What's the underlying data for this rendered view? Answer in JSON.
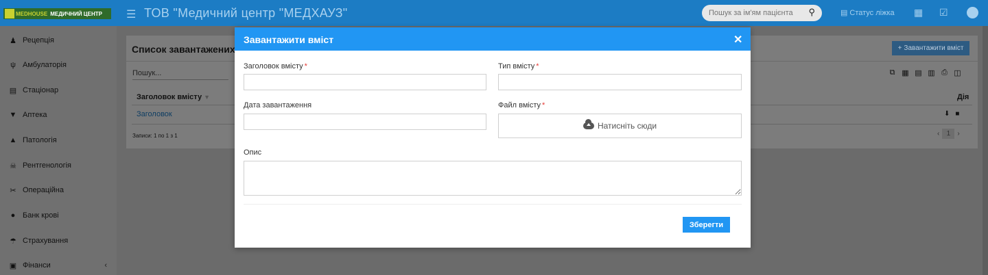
{
  "topbar": {
    "logo_text_1": "MEDHOUSE",
    "logo_text_2": "МЕДИЧНИЙ ЦЕНТР",
    "title": "ТОВ \"Медичний центр \"МЕДХАУЗ\"",
    "search_placeholder": "Пошук за ім'ям пацієнта",
    "bed_status_label": "Статус ліжка"
  },
  "sidebar": {
    "items": [
      {
        "label": "Рецепція",
        "icon": "reception-icon"
      },
      {
        "label": "Амбулаторія",
        "icon": "stethoscope-icon"
      },
      {
        "label": "Стаціонар",
        "icon": "bed-icon"
      },
      {
        "label": "Аптека",
        "icon": "mortar-icon"
      },
      {
        "label": "Патологія",
        "icon": "flask-icon"
      },
      {
        "label": "Рентгенологія",
        "icon": "xray-icon"
      },
      {
        "label": "Операційна",
        "icon": "scissors-icon"
      },
      {
        "label": "Банк крові",
        "icon": "blood-drop-icon"
      },
      {
        "label": "Страхування",
        "icon": "umbrella-icon"
      },
      {
        "label": "Фінанси",
        "icon": "finance-icon"
      }
    ]
  },
  "panel": {
    "title": "Список завантажених",
    "upload_label": "Завантажити вміст",
    "search_label": "Пошук...",
    "col_title": "Заголовок вмісту",
    "col_action": "Дія",
    "row_title": "Заголовок",
    "records_text": "Записи: 1 по 1 з 1",
    "page": "1"
  },
  "modal": {
    "title": "Завантажити вміст",
    "field_title_label": "Заголовок вмісту",
    "field_type_label": "Тип вмісту",
    "field_date_label": "Дата завантаження",
    "field_file_label": "Файл вмісту",
    "dropzone_label": "Натисніть сюди",
    "field_desc_label": "Опис",
    "save_label": "Зберегти",
    "required_mark": "*"
  },
  "colors": {
    "accent": "#2196f3",
    "topbar": "#1c7cc4",
    "required": "#e53935"
  }
}
